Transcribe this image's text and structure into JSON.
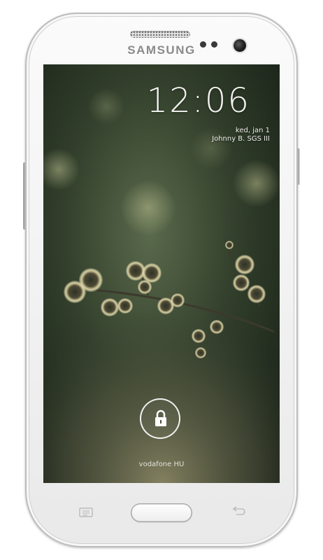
{
  "device": {
    "brand": "SAMSUNG",
    "body_color": "#f4f4f4"
  },
  "lockscreen": {
    "time": "12:06",
    "date": "ked, jan 1",
    "owner_info": "Johnny B. SGS III",
    "carrier": "vodafone HU",
    "unlock_icon": "padlock-icon",
    "text_color": "#f4f4f2"
  },
  "hardware_keys": {
    "menu_icon": "menu-icon",
    "home": "home-button",
    "back_icon": "back-arrow-icon"
  }
}
